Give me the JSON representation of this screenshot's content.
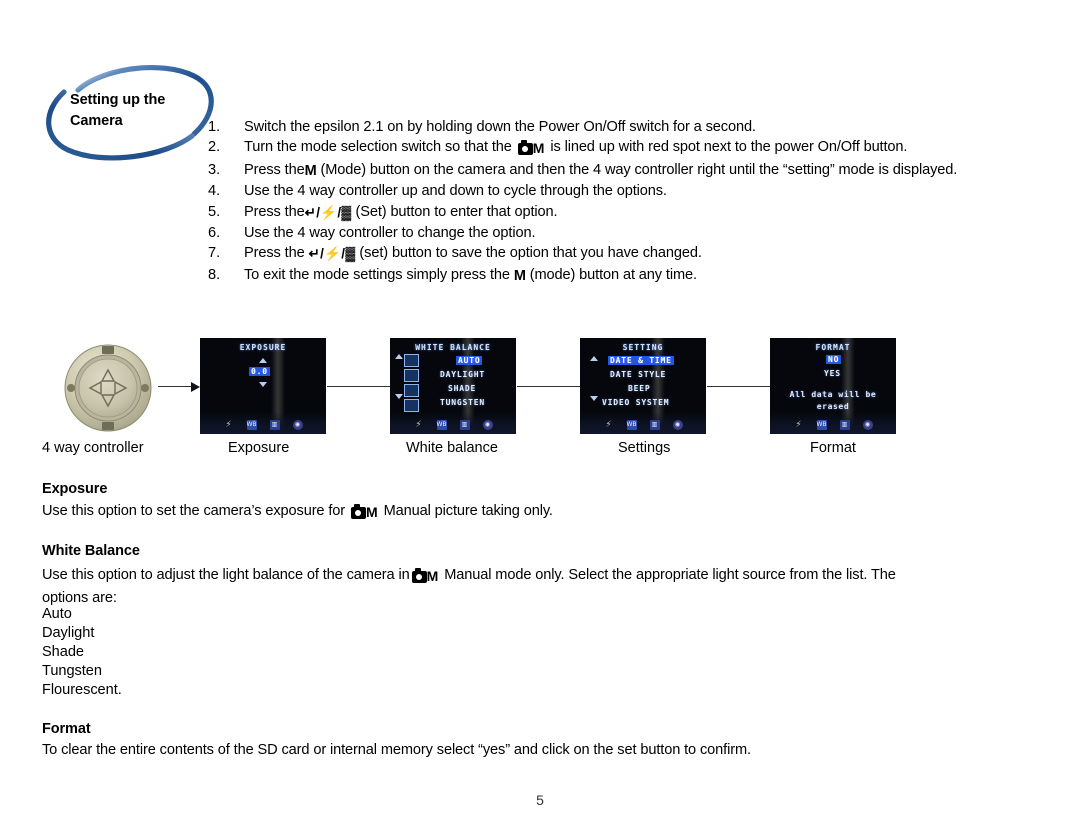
{
  "page": {
    "number": "5"
  },
  "header": {
    "heading": "Setting up the Camera",
    "graphic": "blue-swoosh-ellipse"
  },
  "steps": [
    {
      "num": "1.",
      "parts": [
        {
          "type": "text",
          "value": "Switch the epsilon 2.1 on by holding down the Power On/Off switch for a second."
        }
      ]
    },
    {
      "num": "2.",
      "parts": [
        {
          "type": "text",
          "value": "Turn the mode selection switch so that the "
        },
        {
          "type": "camera-mode-glyph",
          "value": "M"
        },
        {
          "type": "text",
          "value": " is lined up with red spot next to the power On/Off button."
        }
      ]
    },
    {
      "num": "3.",
      "parts": [
        {
          "type": "text",
          "value": "Press the"
        },
        {
          "type": "mode-glyph",
          "value": "M"
        },
        {
          "type": "text",
          "value": " (Mode) button on the camera and then the 4 way controller right until the “setting” mode is displayed."
        }
      ]
    },
    {
      "num": "4.",
      "parts": [
        {
          "type": "text",
          "value": "Use the 4 way controller up and down to cycle through the options."
        }
      ]
    },
    {
      "num": "5.",
      "parts": [
        {
          "type": "text",
          "value": "Press the"
        },
        {
          "type": "set-glyph",
          "value": "↵/⚡/▓"
        },
        {
          "type": "text",
          "value": " (Set) button to enter that option."
        }
      ]
    },
    {
      "num": "6.",
      "parts": [
        {
          "type": "text",
          "value": "Use the 4 way controller to change the option."
        }
      ]
    },
    {
      "num": "7.",
      "parts": [
        {
          "type": "text",
          "value": "Press the "
        },
        {
          "type": "set-glyph",
          "value": "↵/⚡/▓"
        },
        {
          "type": "text",
          "value": " (set) button to save the option that you have changed."
        }
      ]
    },
    {
      "num": "8.",
      "parts": [
        {
          "type": "text",
          "value": "To exit the mode settings simply press the "
        },
        {
          "type": "mode-glyph",
          "value": "M"
        },
        {
          "type": "text",
          "value": " (mode) button at any time."
        }
      ]
    }
  ],
  "flow": {
    "controller": {
      "caption": "4 way controller",
      "icon": "four-way-controller-dial"
    },
    "screens": [
      {
        "caption": "Exposure",
        "title": "EXPOSURE",
        "value": "0.0",
        "has_up_arrow": true,
        "has_down_arrow": true,
        "options": [],
        "note": "",
        "iconbar": [
          "flash-off-icon",
          "WB",
          "drive-icon",
          "set-icon"
        ]
      },
      {
        "caption": "White balance",
        "title": "WHITE BALANCE",
        "value": "",
        "has_up_arrow": true,
        "has_down_arrow": true,
        "options": [
          {
            "label": "AUTO",
            "selected": true
          },
          {
            "label": "DAYLIGHT",
            "selected": false
          },
          {
            "label": "SHADE",
            "selected": false
          },
          {
            "label": "TUNGSTEN",
            "selected": false
          }
        ],
        "note": "",
        "iconbar": [
          "flash-off-icon",
          "WB",
          "drive-icon",
          "set-icon"
        ]
      },
      {
        "caption": "Settings",
        "title": "SETTING",
        "value": "",
        "has_up_arrow": true,
        "has_down_arrow": true,
        "options": [
          {
            "label": "DATE & TIME",
            "selected": true
          },
          {
            "label": "DATE STYLE",
            "selected": false
          },
          {
            "label": "BEEP",
            "selected": false
          },
          {
            "label": "VIDEO SYSTEM",
            "selected": false
          }
        ],
        "note": "",
        "iconbar": [
          "flash-off-icon",
          "WB",
          "drive-icon",
          "set-icon"
        ]
      },
      {
        "caption": "Format",
        "title": "FORMAT",
        "value": "",
        "has_up_arrow": false,
        "has_down_arrow": false,
        "options": [
          {
            "label": "NO",
            "selected": true
          },
          {
            "label": "YES",
            "selected": false
          }
        ],
        "note_line1": "All data will be",
        "note_line2": "erased",
        "iconbar": [
          "flash-off-icon",
          "WB",
          "drive-icon",
          "set-icon"
        ]
      }
    ]
  },
  "sections": {
    "exposure": {
      "heading": "Exposure",
      "text_before": "Use this option to set the camera’s exposure for",
      "text_after": "Manual picture taking only."
    },
    "white_balance": {
      "heading": "White Balance",
      "text_before": "Use this option to adjust the light balance of the camera in",
      "text_after": "Manual mode only. Select the appropriate light source from the list. The options are:",
      "options": [
        "Auto",
        "Daylight",
        "Shade",
        "Tungsten",
        "Flourescent."
      ]
    },
    "format": {
      "heading": "Format",
      "text": "To clear the entire contents of the SD card or internal memory select “yes” and click on the set button to confirm."
    }
  },
  "colors": {
    "swoosh": "#2e5f96",
    "lcd_background": "#05070d",
    "lcd_highlight": "#1f56e8",
    "lcd_text": "#e6eeff",
    "arrow": "#2e3338"
  }
}
